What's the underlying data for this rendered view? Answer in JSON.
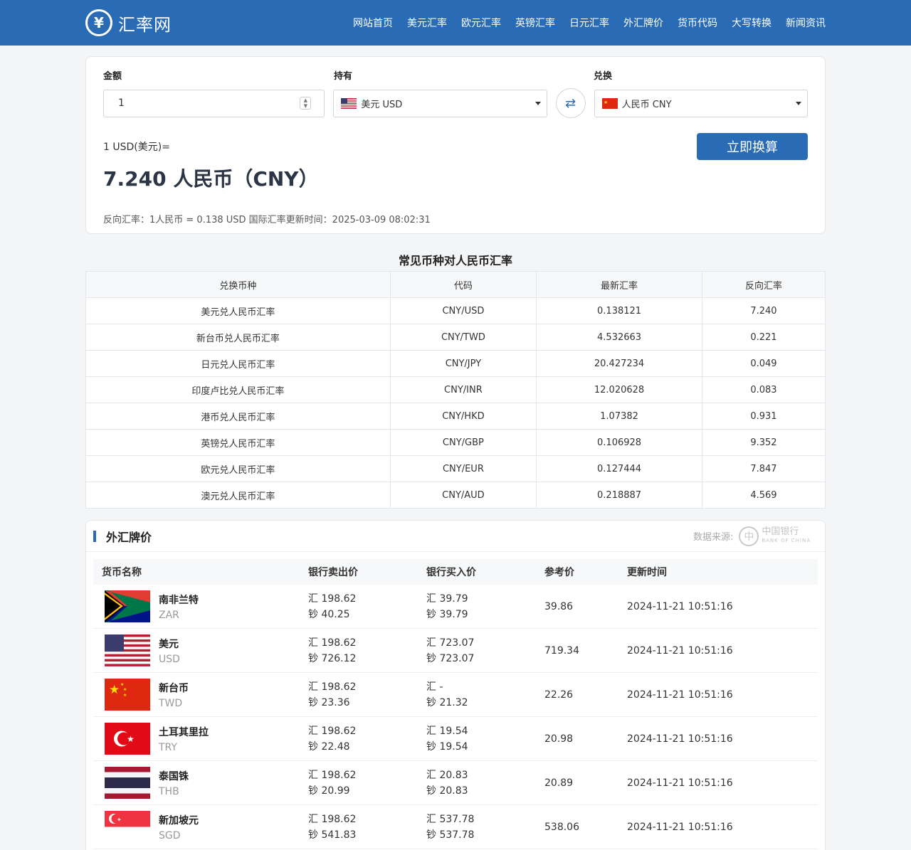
{
  "brand": {
    "name": "汇率网"
  },
  "nav": [
    "网站首页",
    "美元汇率",
    "欧元汇率",
    "英镑汇率",
    "日元汇率",
    "外汇牌价",
    "货币代码",
    "大写转换",
    "新闻资讯"
  ],
  "converter": {
    "amount_label": "金额",
    "hold_label": "持有",
    "exchange_label": "兑换",
    "amount_value": "1",
    "from_currency": "美元 USD",
    "to_currency": "人民币 CNY",
    "result_small": "1 USD(美元)=",
    "result_big": "7.240 人民币（CNY）",
    "note": "反向汇率：1人民币 = 0.138 USD  国际汇率更新时间：2025-03-09 08:02:31",
    "convert_button": "立即换算"
  },
  "common": {
    "title": "常见币种对人民币汇率",
    "headers": [
      "兑换币种",
      "代码",
      "最新汇率",
      "反向汇率"
    ],
    "rows": [
      [
        "美元兑人民币汇率",
        "CNY/USD",
        "0.138121",
        "7.240"
      ],
      [
        "新台币兑人民币汇率",
        "CNY/TWD",
        "4.532663",
        "0.221"
      ],
      [
        "日元兑人民币汇率",
        "CNY/JPY",
        "20.427234",
        "0.049"
      ],
      [
        "印度卢比兑人民币汇率",
        "CNY/INR",
        "12.020628",
        "0.083"
      ],
      [
        "港币兑人民币汇率",
        "CNY/HKD",
        "1.07382",
        "0.931"
      ],
      [
        "英镑兑人民币汇率",
        "CNY/GBP",
        "0.106928",
        "9.352"
      ],
      [
        "欧元兑人民币汇率",
        "CNY/EUR",
        "0.127444",
        "7.847"
      ],
      [
        "澳元兑人民币汇率",
        "CNY/AUD",
        "0.218887",
        "4.569"
      ]
    ]
  },
  "forex": {
    "title": "外汇牌价",
    "source_label": "数据来源:",
    "bank_name_cn": "中国银行",
    "bank_name_en": "BANK OF CHINA",
    "headers": [
      "货币名称",
      "银行卖出价",
      "银行买入价",
      "参考价",
      "更新时间"
    ],
    "rows": [
      {
        "flag": "za",
        "name": "南非兰特",
        "code": "ZAR",
        "sell_1": "汇 198.62",
        "sell_2": "钞 40.25",
        "buy_1": "汇 39.79",
        "buy_2": "钞 39.79",
        "ref": "39.86",
        "time": "2024-11-21 10:51:16"
      },
      {
        "flag": "us",
        "name": "美元",
        "code": "USD",
        "sell_1": "汇 198.62",
        "sell_2": "钞 726.12",
        "buy_1": "汇 723.07",
        "buy_2": "钞 723.07",
        "ref": "719.34",
        "time": "2024-11-21 10:51:16"
      },
      {
        "flag": "cn",
        "name": "新台币",
        "code": "TWD",
        "sell_1": "汇 198.62",
        "sell_2": "钞 23.36",
        "buy_1": "汇 -",
        "buy_2": "钞 21.32",
        "ref": "22.26",
        "time": "2024-11-21 10:51:16"
      },
      {
        "flag": "tr",
        "name": "土耳其里拉",
        "code": "TRY",
        "sell_1": "汇 198.62",
        "sell_2": "钞 22.48",
        "buy_1": "汇 19.54",
        "buy_2": "钞 19.54",
        "ref": "20.98",
        "time": "2024-11-21 10:51:16"
      },
      {
        "flag": "th",
        "name": "泰国铢",
        "code": "THB",
        "sell_1": "汇 198.62",
        "sell_2": "钞 20.99",
        "buy_1": "汇 20.83",
        "buy_2": "钞 20.83",
        "ref": "20.89",
        "time": "2024-11-21 10:51:16"
      },
      {
        "flag": "sg",
        "name": "新加坡元",
        "code": "SGD",
        "sell_1": "汇 198.62",
        "sell_2": "钞 541.83",
        "buy_1": "汇 537.78",
        "buy_2": "钞 537.78",
        "ref": "538.06",
        "time": "2024-11-21 10:51:16"
      }
    ]
  },
  "colors": {
    "primary": "#2a6bb5"
  }
}
